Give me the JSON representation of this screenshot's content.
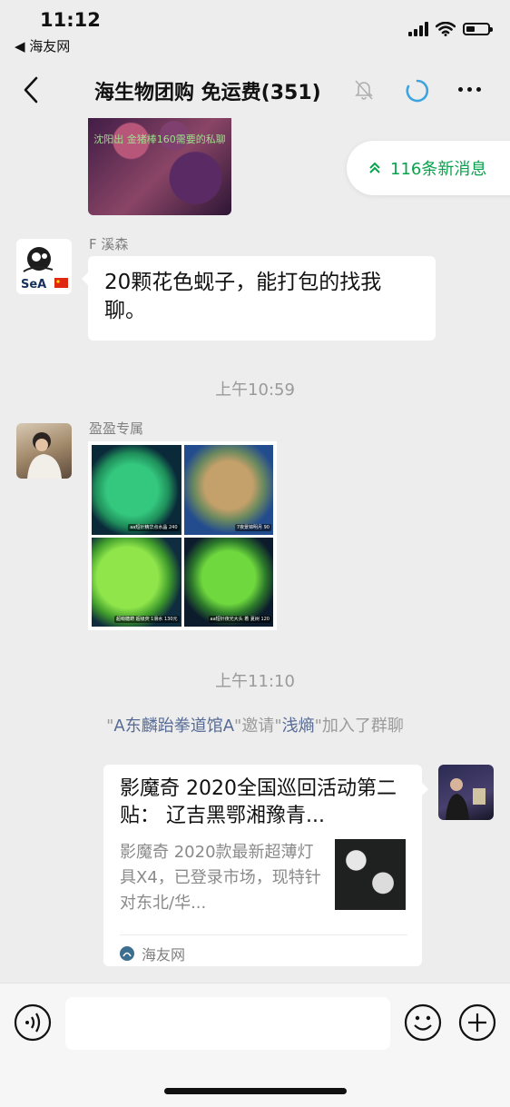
{
  "status_bar": {
    "time": "11:12",
    "back_app": "◀ 海友网"
  },
  "nav": {
    "title": "海生物团购  免运费(351)"
  },
  "top_image": {
    "caption": "沈阳出 金猪棒160需要的私聊"
  },
  "new_messages": {
    "label": "116条新消息"
  },
  "messages": [
    {
      "sender": "F 溪森",
      "text": "20颗花色蚬子，能打包的找我聊。"
    }
  ],
  "timestamps": {
    "t1": "上午10:59",
    "t2": "上午11:10"
  },
  "image_message": {
    "sender": "盈盈专属",
    "labels": [
      "aa短针精华点水晶 240",
      "7夜景锦明月 90",
      "超萌糖葫 超级荧 1滑水 130元",
      "aa短针夜光大头 着 夏树 120"
    ]
  },
  "system_message": {
    "inviter": "A东麟跆拳道馆A",
    "invited_word": "邀请",
    "invitee": "浅熵",
    "joined": "加入了群聊"
  },
  "link_card": {
    "title": "影魔奇 2020全国巡回活动第二贴： 辽吉黑鄂湘豫青...",
    "desc": "影魔奇 2020款最新超薄灯具X4，已登录市场，现特针对东北/华...",
    "source": "海友网"
  },
  "input": {
    "placeholder": ""
  },
  "colors": {
    "accent_green": "#07a34c",
    "link_blue": "#576b95",
    "sync_blue": "#3da4e0"
  }
}
